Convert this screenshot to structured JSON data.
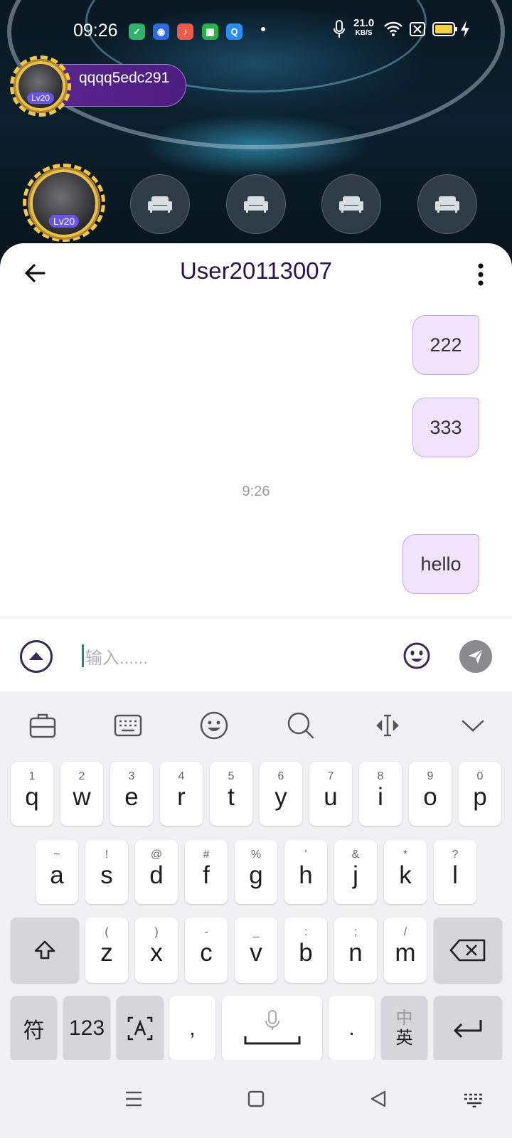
{
  "status_bar": {
    "time": "09:26",
    "net_speed_value": "21.0",
    "net_speed_unit": "KB/S",
    "app_icons": [
      "shield-app-icon",
      "baidu-app-icon",
      "music-app-icon",
      "store-app-icon",
      "browser-app-icon"
    ]
  },
  "room": {
    "owner_name": "qqqq5edc291",
    "owner_level": "Lv20",
    "host_level": "Lv20",
    "seat_icon": "sofa-icon",
    "seat_count": 4
  },
  "chat": {
    "title": "User20113007",
    "messages": [
      {
        "text": "222",
        "side": "right"
      },
      {
        "text": "333",
        "side": "right"
      },
      {
        "text": "hello",
        "side": "right"
      }
    ],
    "timestamp": "9:26"
  },
  "input": {
    "placeholder": "输入......"
  },
  "keyboard": {
    "toolbar_icons": [
      "clipboard-icon",
      "keyboard-layout-icon",
      "emoji-icon",
      "search-icon",
      "cursor-move-icon",
      "collapse-icon"
    ],
    "row1": [
      {
        "main": "q",
        "sup": "1"
      },
      {
        "main": "w",
        "sup": "2"
      },
      {
        "main": "e",
        "sup": "3"
      },
      {
        "main": "r",
        "sup": "4"
      },
      {
        "main": "t",
        "sup": "5"
      },
      {
        "main": "y",
        "sup": "6"
      },
      {
        "main": "u",
        "sup": "7"
      },
      {
        "main": "i",
        "sup": "8"
      },
      {
        "main": "o",
        "sup": "9"
      },
      {
        "main": "p",
        "sup": "0"
      }
    ],
    "row2": [
      {
        "main": "a",
        "sup": "~"
      },
      {
        "main": "s",
        "sup": "!"
      },
      {
        "main": "d",
        "sup": "@"
      },
      {
        "main": "f",
        "sup": "#"
      },
      {
        "main": "g",
        "sup": "%"
      },
      {
        "main": "h",
        "sup": "'"
      },
      {
        "main": "j",
        "sup": "&"
      },
      {
        "main": "k",
        "sup": "*"
      },
      {
        "main": "l",
        "sup": "?"
      }
    ],
    "row3": [
      {
        "main": "z",
        "sup": "("
      },
      {
        "main": "x",
        "sup": ")"
      },
      {
        "main": "c",
        "sup": "-"
      },
      {
        "main": "v",
        "sup": "_"
      },
      {
        "main": "b",
        "sup": ":"
      },
      {
        "main": "n",
        "sup": ";"
      },
      {
        "main": "m",
        "sup": "/"
      }
    ],
    "symbols_label": "符",
    "numbers_label": "123",
    "comma": ",",
    "period": ".",
    "lang_top": "中",
    "lang_bottom": "英"
  },
  "colors": {
    "accent_purple": "#2b1454",
    "bubble_fill": "#efe4fb",
    "bubble_border": "#c9a9ef",
    "room_pill": "#5a2790"
  }
}
